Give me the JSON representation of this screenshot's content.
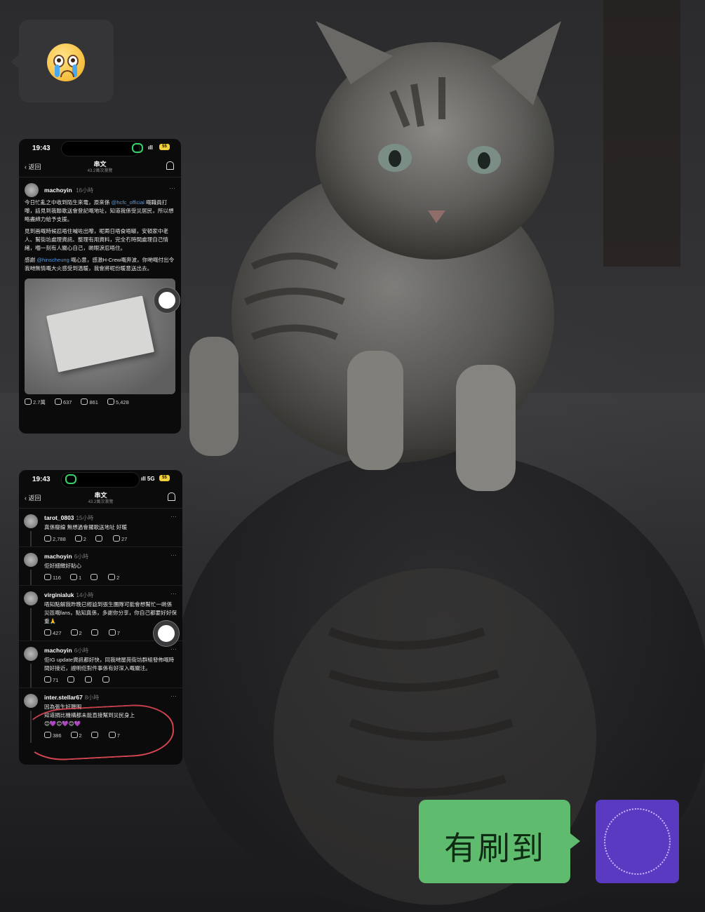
{
  "chat": {
    "incoming_emoji": "😭",
    "outgoing_message": "有刷到"
  },
  "screenshot1": {
    "status_time": "19:43",
    "battery": "55",
    "nav_back": "返回",
    "nav_title": "串文",
    "nav_views": "43.2萬次瀏覽",
    "post": {
      "username": "machoyin",
      "time": "16小時",
      "para1_a": "今日忙亂之中收到陌生來電，原來係 ",
      "para1_mention": "@hcfc_official",
      "para1_b": " 嘅職員打嚟，話見到我聯歌送會登記嘅地址，知道我係受災居民，所以想略盡綿力給予支援。",
      "para2": "見到画嘅時候忍唔住喊咗出嚟，呢兩日唔食唔瞓，安頓家中老人、幫街坊處理資訊、整理有用資料，完全冇時間處理自己情緒，嗰一刻有人關心自己，啲眼淚忍唔住。",
      "para3_a": "感謝 ",
      "para3_mention": "@hinscheung",
      "para3_b": " 嘅心意，感激H-Crew嘅奔波，你哋嘅付出令我哋無情嘅大火感受到溫暖，我會將呢份暖意送出去。",
      "likes": "2.7萬",
      "comments": "637",
      "reposts": "861",
      "shares": "5,428"
    }
  },
  "screenshot2": {
    "status_time": "19:43",
    "signal": "5G",
    "battery": "55",
    "nav_back": "返回",
    "nav_title": "串文",
    "nav_views": "43.2萬次瀏覽",
    "replies": [
      {
        "username": "tarot_0803",
        "time": "15小時",
        "text": "真係癡線 無想過會攞歌送地址 好暖",
        "likes": "2,788",
        "comments": "2",
        "shares": "27"
      },
      {
        "username": "machoyin",
        "time": "6小時",
        "text": "佢好細緻好貼心",
        "likes": "116",
        "comments": "1",
        "shares": "2"
      },
      {
        "username": "virginialuk",
        "time": "14小時",
        "text": "唔知點解我昨晚已經諗到張生團隊可能會想幫忙一啲係災區嘅fans，點知真係，多謝你分享，你自己都要好好保重🙏",
        "likes": "427",
        "comments": "2",
        "shares": "7"
      },
      {
        "username": "machoyin",
        "time": "6小時",
        "text": "佢IG update資訊都好快，同我哋屋苑街坊群組發佈嘅時間好接近，證明佢對件事係有好深入嘅關注。",
        "likes": "71",
        "comments": "",
        "shares": ""
      },
      {
        "username": "inter.stellar67",
        "time": "8小時",
        "text": "因為張生好聰明\n知道捐比機構都未能直接幫到災民身上\n😊💜😊💜😊💜",
        "likes": "386",
        "comments": "2",
        "shares": "7"
      }
    ]
  },
  "colors": {
    "outgoing_bubble": "#5fbb6d",
    "incoming_bubble": "#353537",
    "avatar_bg": "#5a3ac0",
    "mention": "#4a9df0",
    "annotation_circle": "#d64552"
  }
}
